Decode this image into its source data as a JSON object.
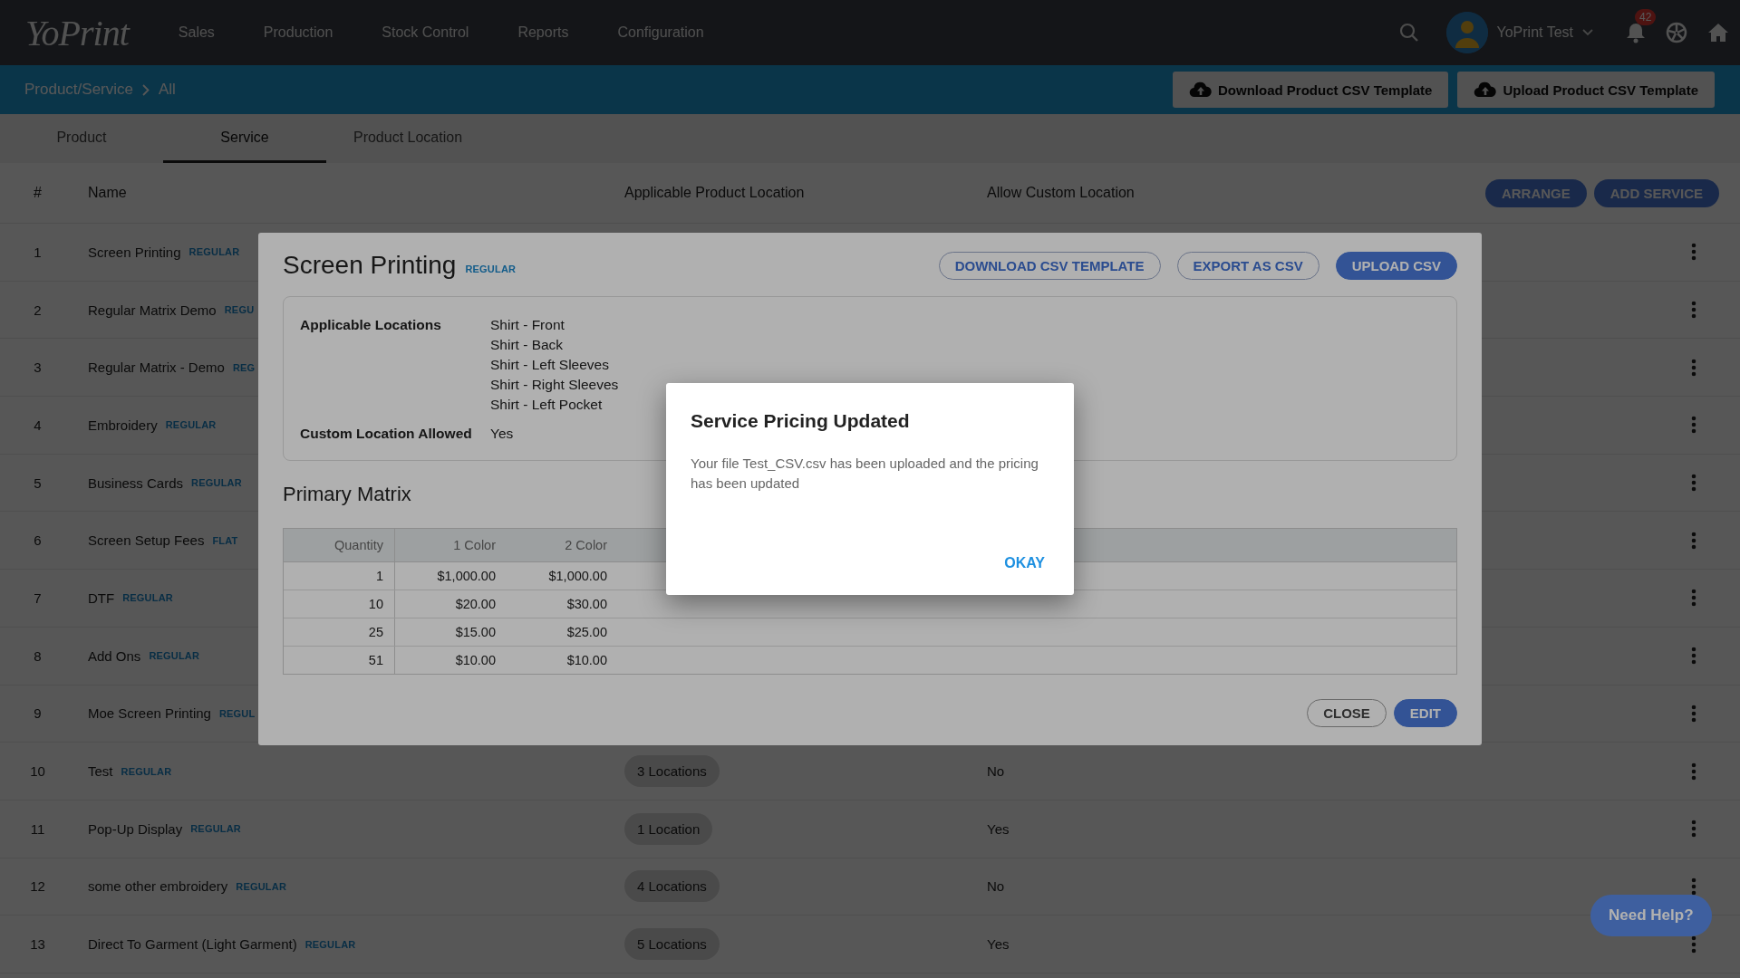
{
  "top_nav": {
    "logo": "YoPrint",
    "menu": [
      "Sales",
      "Production",
      "Stock Control",
      "Reports",
      "Configuration"
    ],
    "user": "YoPrint Test",
    "notification_count": "42"
  },
  "breadcrumb": [
    "Product/Service",
    "All"
  ],
  "header_buttons": [
    "Download Product CSV Template",
    "Upload Product CSV Template"
  ],
  "tabs": [
    {
      "label": "Product",
      "selected": false
    },
    {
      "label": "Service",
      "selected": true
    },
    {
      "label": "Product Location",
      "selected": false
    }
  ],
  "table": {
    "columns": [
      "#",
      "Name",
      "Applicable Product Location",
      "Allow Custom Location"
    ],
    "buttons": [
      "ARRANGE",
      "ADD SERVICE"
    ],
    "rows": [
      {
        "number": "1",
        "name": "Screen Printing",
        "tag": "REGULAR"
      },
      {
        "number": "2",
        "name": "Regular Matrix Demo",
        "tag": "REGU"
      },
      {
        "number": "3",
        "name": "Regular Matrix - Demo",
        "tag": "REG"
      },
      {
        "number": "4",
        "name": "Embroidery",
        "tag": "REGULAR"
      },
      {
        "number": "5",
        "name": "Business Cards",
        "tag": "REGULAR"
      },
      {
        "number": "6",
        "name": "Screen Setup Fees",
        "tag": "FLAT"
      },
      {
        "number": "7",
        "name": "DTF",
        "tag": "REGULAR"
      },
      {
        "number": "8",
        "name": "Add Ons",
        "tag": "REGULAR"
      },
      {
        "number": "9",
        "name": "Moe Screen Printing",
        "tag": "REGUL"
      },
      {
        "number": "10",
        "name": "Test",
        "tag": "REGULAR",
        "locations": "3 Locations",
        "custom_location": "No"
      },
      {
        "number": "11",
        "name": "Pop-Up Display",
        "tag": "REGULAR",
        "locations": "1 Location",
        "custom_location": "Yes"
      },
      {
        "number": "12",
        "name": "some other embroidery",
        "tag": "REGULAR",
        "locations": "4 Locations",
        "custom_location": "No"
      },
      {
        "number": "13",
        "name": "Direct To Garment (Light Garment)",
        "tag": "REGULAR",
        "locations": "5 Locations",
        "custom_location": "Yes"
      }
    ]
  },
  "service_modal": {
    "title": "Screen Printing",
    "tag": "REGULAR",
    "buttons": [
      {
        "label": "DOWNLOAD CSV TEMPLATE",
        "kind": "outlined"
      },
      {
        "label": "EXPORT AS CSV",
        "kind": "outlined"
      },
      {
        "label": "UPLOAD CSV",
        "kind": "filled"
      }
    ],
    "details": [
      {
        "label": "Applicable Locations",
        "values": [
          "Shirt - Front",
          "Shirt - Back",
          "Shirt - Left Sleeves",
          "Shirt - Right Sleeves",
          "Shirt - Left Pocket"
        ]
      },
      {
        "label": "Custom Location Allowed",
        "values": [
          "Yes"
        ]
      }
    ],
    "matrix_title": "Primary Matrix",
    "matrix": {
      "columns": [
        "Quantity",
        "1 Color",
        "2 Color"
      ],
      "rows": [
        [
          "1",
          "$1,000.00",
          "$1,000.00"
        ],
        [
          "10",
          "$20.00",
          "$30.00"
        ],
        [
          "25",
          "$15.00",
          "$25.00"
        ],
        [
          "51",
          "$10.00",
          "$10.00"
        ]
      ]
    },
    "footer_buttons": [
      {
        "label": "CLOSE",
        "kind": "outlined"
      },
      {
        "label": "EDIT",
        "kind": "filled"
      }
    ]
  },
  "alert_dialog": {
    "title": "Service Pricing Updated",
    "message": "Your file Test_CSV.csv has been uploaded and the pricing has been updated",
    "button": "OKAY"
  },
  "help_button": "Need Help?"
}
